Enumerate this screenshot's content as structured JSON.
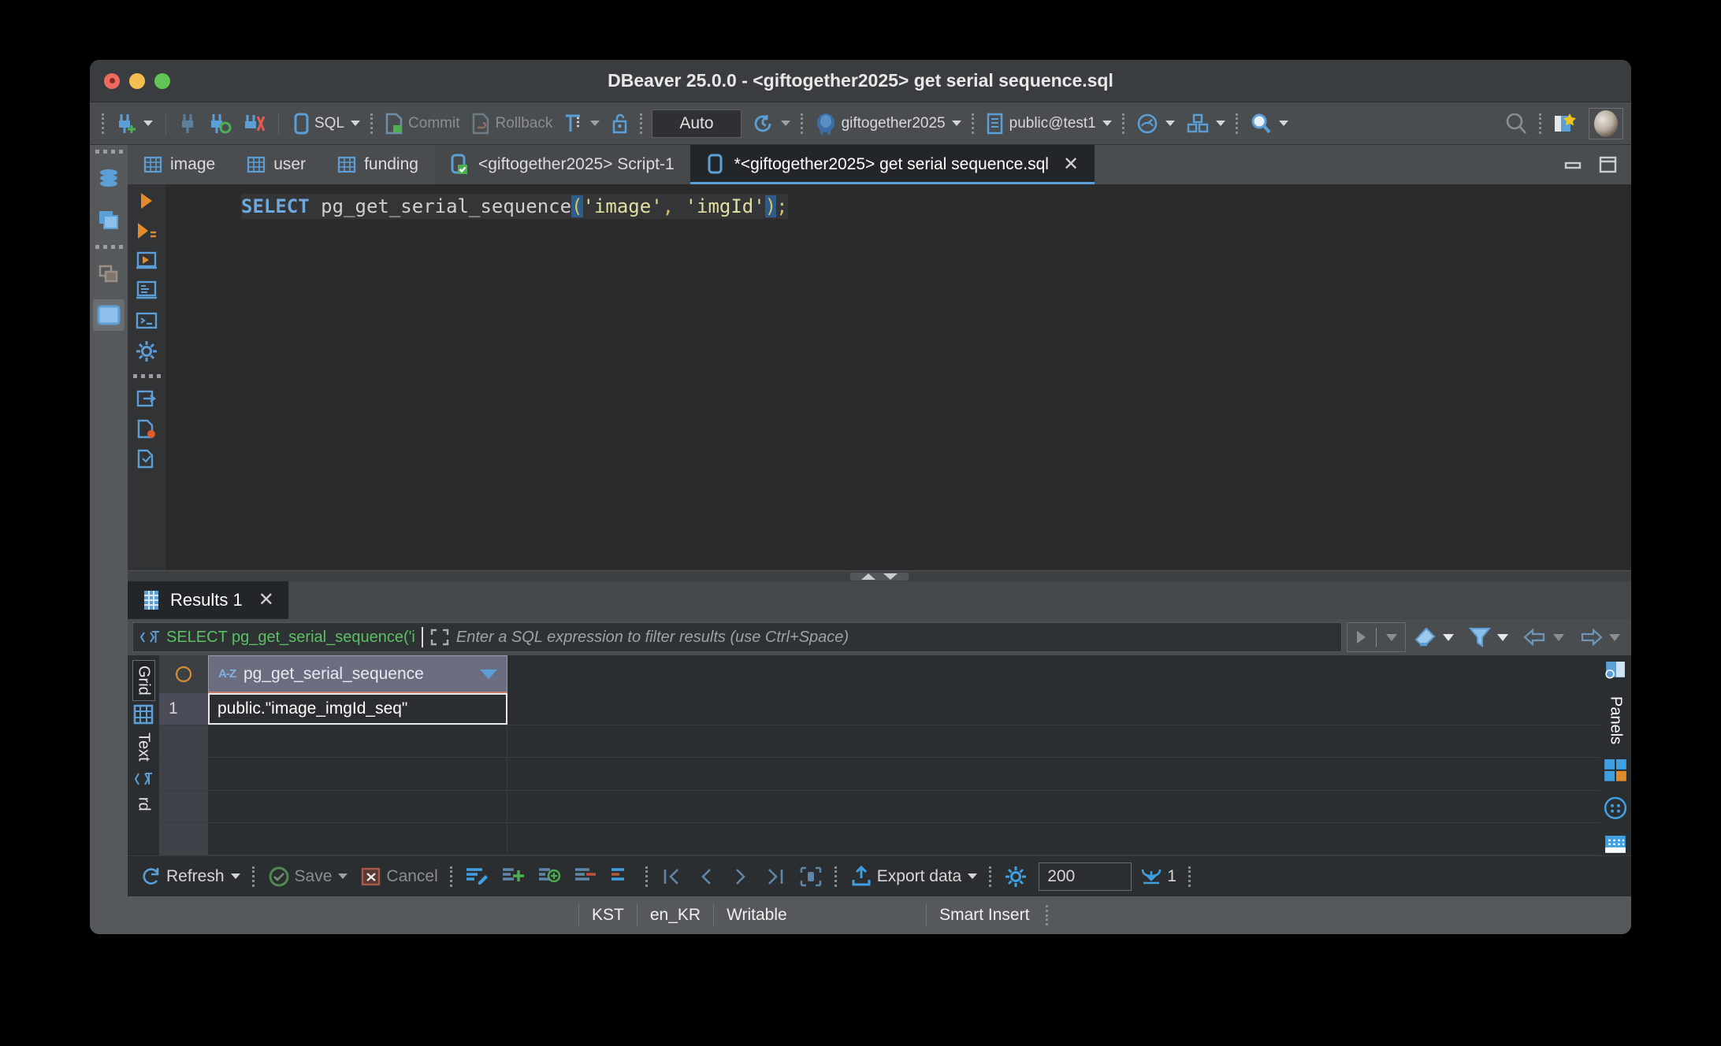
{
  "window": {
    "title": "DBeaver 25.0.0 - <giftogether2025> get serial sequence.sql"
  },
  "toolbar": {
    "sql_label": "SQL",
    "commit_label": "Commit",
    "rollback_label": "Rollback",
    "auto_label": "Auto",
    "database_label": "giftogether2025",
    "schema_label": "public@test1"
  },
  "tabs": [
    {
      "label": "image",
      "icon": "table-icon",
      "state": "inactive"
    },
    {
      "label": "user",
      "icon": "table-icon",
      "state": "inactive"
    },
    {
      "label": "funding",
      "icon": "table-icon",
      "state": "inactive"
    },
    {
      "label": "<giftogether2025> Script-1",
      "icon": "sql-script-saved-icon",
      "state": "inactive"
    },
    {
      "label": "*<giftogether2025> get serial sequence.sql",
      "icon": "sql-script-icon",
      "state": "active"
    }
  ],
  "editor": {
    "code": {
      "keyword": "SELECT",
      "function": " pg_get_serial_sequence",
      "open_paren": "(",
      "arg1": "'image'",
      "comma": ", ",
      "arg2": "'imgId'",
      "close_paren": ")",
      "semicolon": ";"
    },
    "full_text": "SELECT pg_get_serial_sequence('image', 'imgId');"
  },
  "results": {
    "tab_label": "Results 1",
    "filter": {
      "query_text": "SELECT pg_get_serial_sequence('i",
      "placeholder": "Enter a SQL expression to filter results (use Ctrl+Space)"
    },
    "grid": {
      "vertical_tabs": [
        "Grid",
        "Text",
        "rd"
      ],
      "column_sort_badge": "A-Z",
      "columns": [
        "pg_get_serial_sequence"
      ],
      "rows": [
        {
          "num": "1",
          "values": [
            "public.\"image_imgId_seq\""
          ]
        }
      ],
      "empty_row_count": 4,
      "panels_label": "Panels"
    },
    "toolbar": {
      "refresh_label": "Refresh",
      "save_label": "Save",
      "cancel_label": "Cancel",
      "export_label": "Export data",
      "fetch_size": "200",
      "page_count": "1"
    }
  },
  "statusbar": {
    "timezone": "KST",
    "locale": "en_KR",
    "writable": "Writable",
    "insert_mode": "Smart Insert"
  },
  "colors": {
    "accent_blue": "#5c9ed6",
    "keyword_blue": "#6fa8dc",
    "string_yellow": "#e3dfa0",
    "filter_green": "#5bbf63",
    "window_bg": "#3c4043",
    "editor_bg": "#2b2b2b"
  }
}
